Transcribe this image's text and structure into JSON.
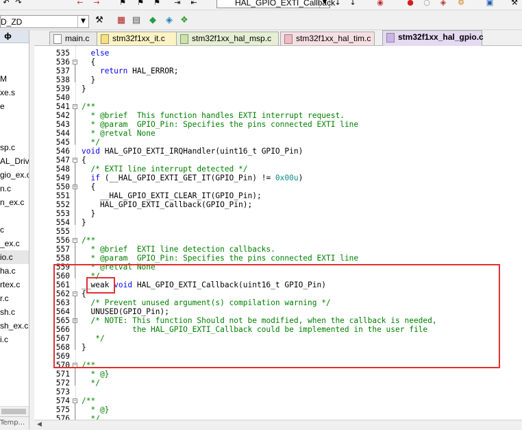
{
  "toolbar": {
    "function_combo": "HAL_GPIO_EXTI_Callback"
  },
  "target": {
    "value": "D_ZD"
  },
  "project": {
    "header": "ф",
    "items": [
      "M",
      "xe.s",
      "e",
      "",
      "sp.c",
      "AL_Driv",
      "gio_ex.c",
      "n.c",
      "n_ex.c",
      "",
      "c",
      "_ex.c",
      "io.c",
      "ha.c",
      "rtex.c",
      "r.c",
      "sh.c",
      "sh_ex.c",
      "i.c"
    ],
    "footer": "Temp..."
  },
  "tabs": [
    {
      "label": "main.c",
      "color": "#e8e8e8",
      "icon_color": "#ffffff"
    },
    {
      "label": "stm32f1xx_it.c",
      "color": "#fbf3c4",
      "icon_color": "#f7e27a"
    },
    {
      "label": "stm32f1xx_hal_msp.c",
      "color": "#e4efd3",
      "icon_color": "#cde3a8"
    },
    {
      "label": "stm32f1xx_hal_tim.c",
      "color": "#f6dfe3",
      "icon_color": "#f2b9c3"
    },
    {
      "label": "stm32f1xx_hal_gpio.c",
      "color": "#e6daf2",
      "icon_color": "#cbb3ea"
    }
  ],
  "editor": {
    "lines": [
      {
        "n": "535",
        "fold": "",
        "segs": [
          {
            "t": "  else",
            "c": "kw"
          }
        ]
      },
      {
        "n": "536",
        "fold": "minus",
        "segs": [
          {
            "t": "  {",
            "c": ""
          }
        ]
      },
      {
        "n": "537",
        "fold": "",
        "segs": [
          {
            "t": "    ",
            "c": ""
          },
          {
            "t": "return",
            "c": "kw"
          },
          {
            "t": " HAL_ERROR;",
            "c": ""
          }
        ]
      },
      {
        "n": "538",
        "fold": "",
        "segs": [
          {
            "t": "  }",
            "c": ""
          }
        ]
      },
      {
        "n": "539",
        "fold": "",
        "segs": [
          {
            "t": "}",
            "c": ""
          }
        ]
      },
      {
        "n": "540",
        "fold": "",
        "segs": [
          {
            "t": "",
            "c": ""
          }
        ]
      },
      {
        "n": "541",
        "fold": "minus",
        "segs": [
          {
            "t": "/**",
            "c": "cm"
          }
        ]
      },
      {
        "n": "542",
        "fold": "",
        "segs": [
          {
            "t": "  * @brief  This function handles EXTI interrupt request.",
            "c": "cm"
          }
        ]
      },
      {
        "n": "543",
        "fold": "",
        "segs": [
          {
            "t": "  * @param  GPIO_Pin: Specifies the pins connected EXTI line",
            "c": "cm"
          }
        ]
      },
      {
        "n": "544",
        "fold": "",
        "segs": [
          {
            "t": "  * @retval None",
            "c": "cm"
          }
        ]
      },
      {
        "n": "545",
        "fold": "",
        "segs": [
          {
            "t": "  */",
            "c": "cm"
          }
        ]
      },
      {
        "n": "546",
        "fold": "",
        "segs": [
          {
            "t": "void",
            "c": "kw"
          },
          {
            "t": " HAL_GPIO_EXTI_IRQHandler(uint16_t GPIO_Pin)",
            "c": ""
          }
        ]
      },
      {
        "n": "547",
        "fold": "minus",
        "segs": [
          {
            "t": "{",
            "c": ""
          }
        ]
      },
      {
        "n": "548",
        "fold": "",
        "segs": [
          {
            "t": "  /* EXTI line interrupt detected */",
            "c": "cm"
          }
        ]
      },
      {
        "n": "549",
        "fold": "",
        "segs": [
          {
            "t": "  ",
            "c": ""
          },
          {
            "t": "if",
            "c": "kw"
          },
          {
            "t": " (__HAL_GPIO_EXTI_GET_IT(GPIO_Pin) != ",
            "c": ""
          },
          {
            "t": "0x00u",
            "c": "num"
          },
          {
            "t": ")",
            "c": ""
          }
        ]
      },
      {
        "n": "550",
        "fold": "minus",
        "segs": [
          {
            "t": "  {",
            "c": ""
          }
        ]
      },
      {
        "n": "551",
        "fold": "",
        "segs": [
          {
            "t": "    __HAL_GPIO_EXTI_CLEAR_IT(GPIO_Pin);",
            "c": ""
          }
        ]
      },
      {
        "n": "552",
        "fold": "",
        "segs": [
          {
            "t": "    HAL_GPIO_EXTI_Callback(GPIO_Pin);",
            "c": ""
          }
        ]
      },
      {
        "n": "553",
        "fold": "",
        "segs": [
          {
            "t": "  }",
            "c": ""
          }
        ]
      },
      {
        "n": "554",
        "fold": "",
        "segs": [
          {
            "t": "}",
            "c": ""
          }
        ]
      },
      {
        "n": "555",
        "fold": "",
        "segs": [
          {
            "t": "",
            "c": ""
          }
        ]
      },
      {
        "n": "556",
        "fold": "minus",
        "segs": [
          {
            "t": "/**",
            "c": "cm"
          }
        ]
      },
      {
        "n": "557",
        "fold": "",
        "segs": [
          {
            "t": "  * @brief  EXTI line detection callbacks.",
            "c": "cm"
          }
        ]
      },
      {
        "n": "558",
        "fold": "",
        "segs": [
          {
            "t": "  * @param  GPIO_Pin: Specifies the pins connected EXTI line",
            "c": "cm"
          }
        ]
      },
      {
        "n": "559",
        "fold": "",
        "segs": [
          {
            "t": "  * @retval None",
            "c": "cm"
          }
        ]
      },
      {
        "n": "560",
        "fold": "",
        "segs": [
          {
            "t": "  */",
            "c": "cm"
          }
        ]
      },
      {
        "n": "561",
        "fold": "",
        "segs": [
          {
            "t": "__weak",
            "c": ""
          },
          {
            "t": " void",
            "c": "kw"
          },
          {
            "t": " HAL_GPIO_EXTI_Callback(uint16_t GPIO_Pin)",
            "c": ""
          }
        ]
      },
      {
        "n": "562",
        "fold": "minus",
        "segs": [
          {
            "t": "{",
            "c": ""
          }
        ]
      },
      {
        "n": "563",
        "fold": "",
        "segs": [
          {
            "t": "  /* Prevent unused argument(s) compilation warning */",
            "c": "cm"
          }
        ]
      },
      {
        "n": "564",
        "fold": "",
        "segs": [
          {
            "t": "  UNUSED(GPIO_Pin);",
            "c": ""
          }
        ]
      },
      {
        "n": "565",
        "fold": "minus",
        "segs": [
          {
            "t": "  /* NOTE: This function Should not be modified, when the callback is needed,",
            "c": "cm"
          }
        ]
      },
      {
        "n": "566",
        "fold": "",
        "segs": [
          {
            "t": "           the HAL_GPIO_EXTI_Callback could be implemented in the user file",
            "c": "cm"
          }
        ]
      },
      {
        "n": "567",
        "fold": "",
        "segs": [
          {
            "t": "   */",
            "c": "cm"
          }
        ]
      },
      {
        "n": "568",
        "fold": "",
        "segs": [
          {
            "t": "}",
            "c": ""
          }
        ]
      },
      {
        "n": "569",
        "fold": "",
        "segs": [
          {
            "t": "",
            "c": ""
          }
        ]
      },
      {
        "n": "570",
        "fold": "minus",
        "segs": [
          {
            "t": "/**",
            "c": "cm"
          }
        ]
      },
      {
        "n": "571",
        "fold": "",
        "segs": [
          {
            "t": "  * @}",
            "c": "cm"
          }
        ]
      },
      {
        "n": "572",
        "fold": "",
        "segs": [
          {
            "t": "  */",
            "c": "cm"
          }
        ]
      },
      {
        "n": "573",
        "fold": "",
        "segs": [
          {
            "t": "",
            "c": ""
          }
        ]
      },
      {
        "n": "574",
        "fold": "minus",
        "segs": [
          {
            "t": "/**",
            "c": "cm"
          }
        ]
      },
      {
        "n": "575",
        "fold": "",
        "segs": [
          {
            "t": "  * @}",
            "c": "cm"
          }
        ]
      },
      {
        "n": "576",
        "fold": "",
        "segs": [
          {
            "t": "  */",
            "c": "cm"
          }
        ]
      }
    ]
  },
  "annotation_color": "#e03030"
}
